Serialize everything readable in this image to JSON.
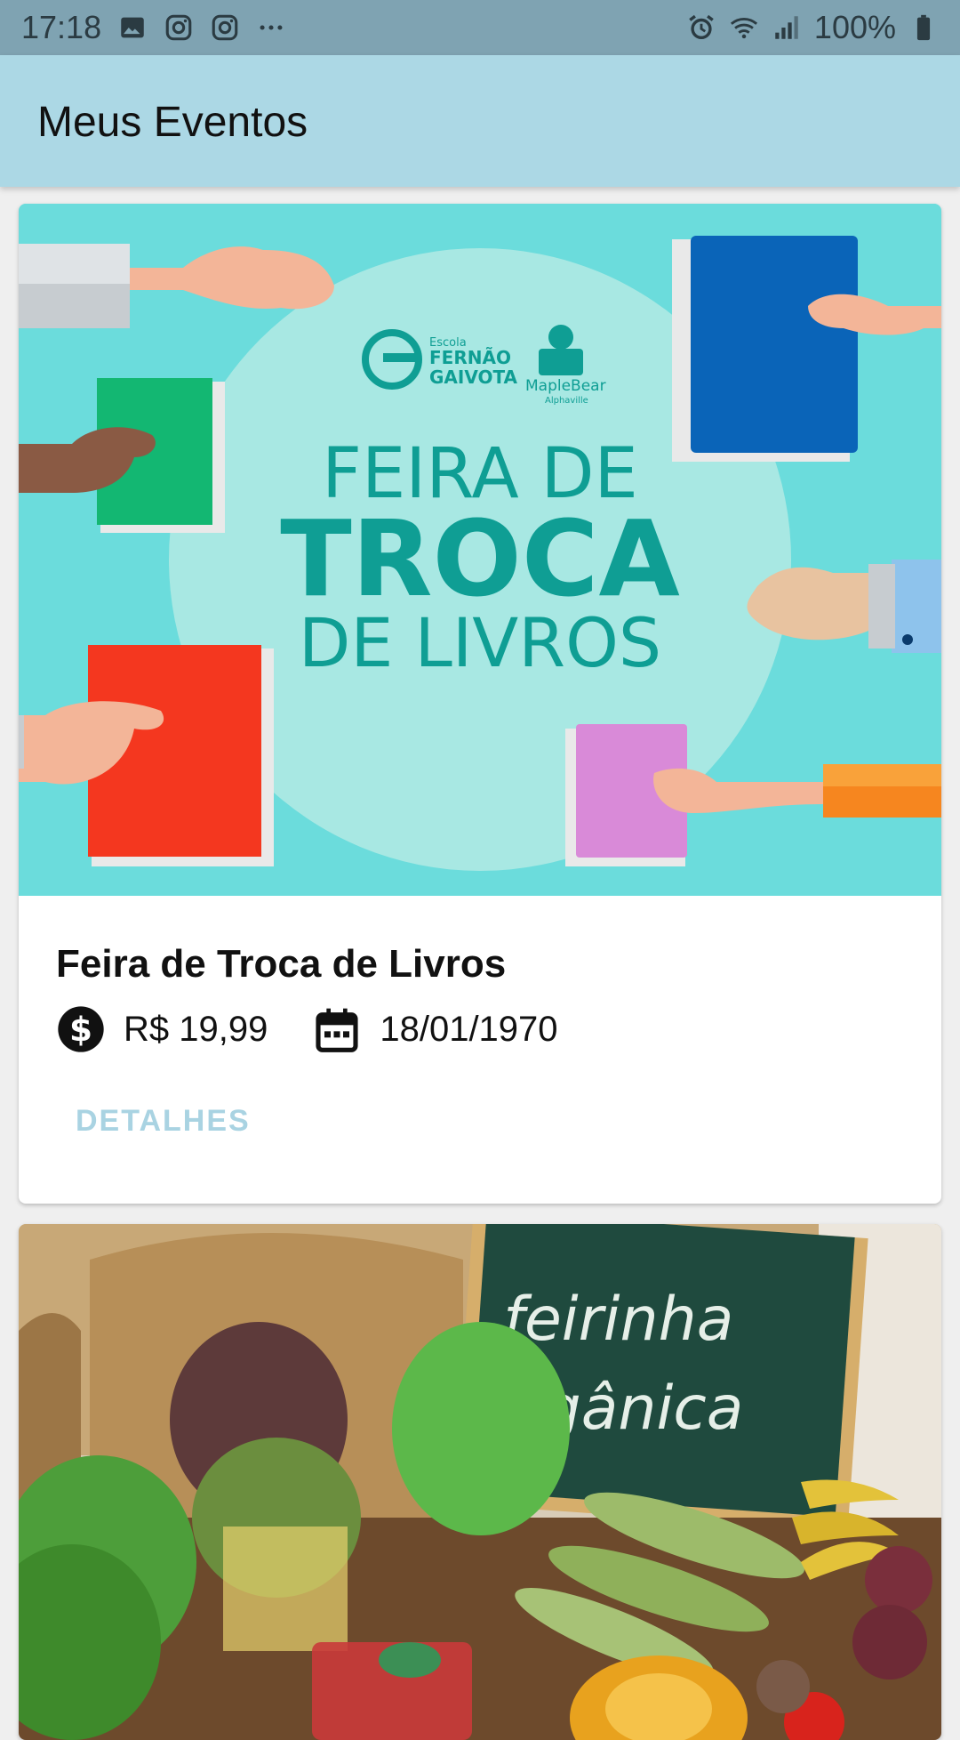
{
  "status_bar": {
    "time": "17:18",
    "battery": "100%",
    "icons": [
      "image-icon",
      "instagram-icon",
      "instagram-icon",
      "more-icon",
      "alarm-icon",
      "wifi-icon",
      "signal-icon",
      "battery-icon"
    ]
  },
  "app_bar": {
    "title": "Meus Eventos"
  },
  "events": [
    {
      "poster": {
        "school_small": "Escola",
        "school_name_1": "FERNÃO",
        "school_name_2": "GAIVOTA",
        "partner": "MapleBear",
        "partner_sub": "Alphaville",
        "line1": "FEIRA DE",
        "line2": "TROCA",
        "line3": "DE LIVROS"
      },
      "title": "Feira de Troca de Livros",
      "price": "R$ 19,99",
      "date": "18/01/1970",
      "details_label": "DETALHES"
    },
    {
      "poster": {
        "sign_line1": "feirinha",
        "sign_line2": "orgânica"
      }
    }
  ],
  "colors": {
    "status_bar": "#7fa3b2",
    "app_bar": "#acd8e5",
    "accent_button": "#a9d3e2",
    "poster_bg": "#6bdcdc",
    "poster_teal": "#0f9e94"
  }
}
